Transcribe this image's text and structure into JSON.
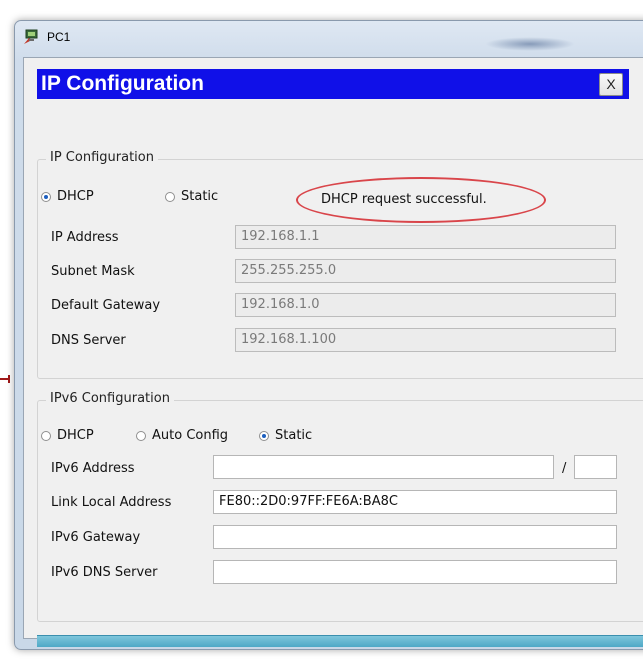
{
  "window": {
    "title": "PC1"
  },
  "dialog": {
    "title": "IP Configuration",
    "close_label": "X"
  },
  "ipv4": {
    "group_label": "IP Configuration",
    "mode_dhcp": "DHCP",
    "mode_static": "Static",
    "selected_mode": "DHCP",
    "status": "DHCP request successful.",
    "ip_address_label": "IP Address",
    "ip_address": "192.168.1.1",
    "subnet_mask_label": "Subnet Mask",
    "subnet_mask": "255.255.255.0",
    "gateway_label": "Default Gateway",
    "gateway": "192.168.1.0",
    "dns_label": "DNS Server",
    "dns": "192.168.1.100"
  },
  "ipv6": {
    "group_label": "IPv6 Configuration",
    "mode_dhcp": "DHCP",
    "mode_auto": "Auto Config",
    "mode_static": "Static",
    "selected_mode": "Static",
    "address_label": "IPv6 Address",
    "address": "",
    "prefix_separator": "/",
    "prefix_length": "",
    "link_local_label": "Link Local Address",
    "link_local": "FE80::2D0:97FF:FE6A:BA8C",
    "gateway_label": "IPv6 Gateway",
    "gateway": "",
    "dns_label": "IPv6 DNS Server",
    "dns": ""
  },
  "colors": {
    "header_bg": "#1010e8",
    "status_oval": "#d9454a",
    "bottom_bar": "#4ea8c6"
  }
}
